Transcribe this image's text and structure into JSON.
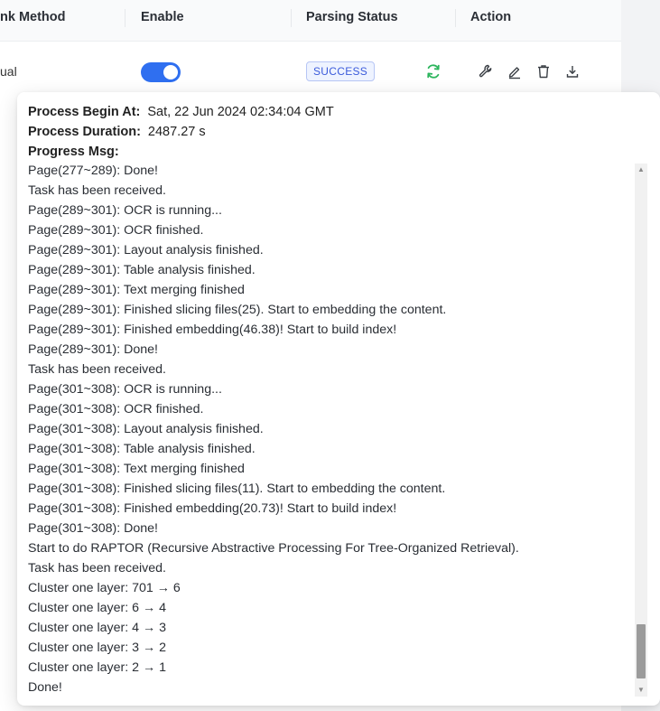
{
  "table": {
    "columns": [
      "nk Method",
      "Enable",
      "Parsing Status",
      "Action"
    ],
    "row": {
      "chunk_method": "ual",
      "enabled": true,
      "status": "SUCCESS"
    },
    "icons": [
      "refresh-icon",
      "wrench-icon",
      "edit-icon",
      "delete-icon",
      "download-icon"
    ],
    "colors": {
      "accent": "#2f6ff0",
      "refresh": "#2db55d",
      "badge_text": "#3b5bdb"
    }
  },
  "popover": {
    "begin_label": "Process Begin At:",
    "begin_value": "Sat, 22 Jun 2024 02:34:04 GMT",
    "duration_label": "Process Duration:",
    "duration_value": "2487.27 s",
    "progress_label": "Progress Msg:",
    "messages": [
      "Page(277~289): Done!",
      "Task has been received.",
      "Page(289~301): OCR is running...",
      "Page(289~301): OCR finished.",
      "Page(289~301): Layout analysis finished.",
      "Page(289~301): Table analysis finished.",
      "Page(289~301): Text merging finished",
      "Page(289~301): Finished slicing files(25). Start to embedding the content.",
      "Page(289~301): Finished embedding(46.38)! Start to build index!",
      "Page(289~301): Done!",
      "Task has been received.",
      "Page(301~308): OCR is running...",
      "Page(301~308): OCR finished.",
      "Page(301~308): Layout analysis finished.",
      "Page(301~308): Table analysis finished.",
      "Page(301~308): Text merging finished",
      "Page(301~308): Finished slicing files(11). Start to embedding the content.",
      "Page(301~308): Finished embedding(20.73)! Start to build index!",
      "Page(301~308): Done!",
      "Start to do RAPTOR (Recursive Abstractive Processing For Tree-Organized Retrieval).",
      "Task has been received.",
      "Cluster one layer: 701 → 6",
      "Cluster one layer: 6 → 4",
      "Cluster one layer: 4 → 3",
      "Cluster one layer: 3 → 2",
      "Cluster one layer: 2 → 1",
      "Done!"
    ]
  }
}
